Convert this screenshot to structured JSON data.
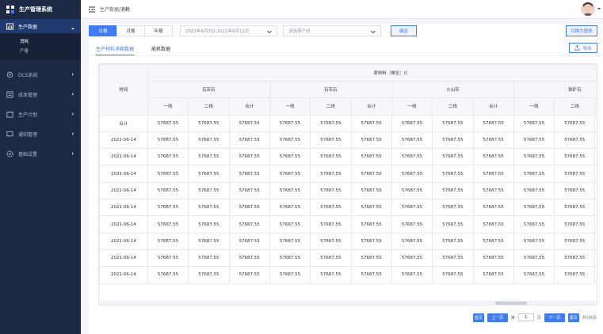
{
  "app": {
    "title": "生产管理系统"
  },
  "sidebar": {
    "items": [
      {
        "label": "生产数据",
        "icon": "chart-icon",
        "active": true,
        "children": [
          {
            "label": "消耗",
            "active": true
          },
          {
            "label": "产量",
            "active": false
          }
        ]
      },
      {
        "label": "DCS系统",
        "icon": "dcs-icon"
      },
      {
        "label": "成本管理",
        "icon": "cost-icon"
      },
      {
        "label": "生产计划",
        "icon": "plan-icon"
      },
      {
        "label": "通知管理",
        "icon": "message-icon"
      },
      {
        "label": "基础设置",
        "icon": "settings-icon"
      }
    ]
  },
  "header": {
    "breadcrumb_parent": "生产数据/",
    "breadcrumb_current": "消耗"
  },
  "filters": {
    "periods": [
      "日报",
      "月报",
      "年报"
    ],
    "active_period": "日报",
    "date_range": "2021年6月3日-2021年6月11日",
    "line_placeholder": "请选择产线",
    "confirm_label": "确定",
    "switch_chart_label": "切换为图表"
  },
  "subtabs": [
    "生产材料消耗数据",
    "能耗数据"
  ],
  "export_label": "导出",
  "table": {
    "time_header": "时间",
    "group_header": "原材料（单位：t）",
    "materials": [
      {
        "name": "石灰石",
        "cols": [
          "一线",
          "二线",
          "合计"
        ]
      },
      {
        "name": "石灰石",
        "cols": [
          "一线",
          "二线",
          "合计"
        ]
      },
      {
        "name": "火山灰",
        "cols": [
          "一线",
          "二线",
          "合计"
        ]
      },
      {
        "name": "铁矿石",
        "cols": [
          "一线",
          "二线",
          ""
        ]
      }
    ],
    "rows": [
      {
        "time": "合计",
        "cells": [
          "57687.55",
          "57687.55",
          "57687.55",
          "57687.55",
          "57687.55",
          "57687.55",
          "57687.55",
          "57687.55",
          "57687.55",
          "57687.55",
          "57687.55",
          ""
        ]
      },
      {
        "time": "2021-06-14",
        "cells": [
          "57687.55",
          "57687.55",
          "57687.55",
          "57687.55",
          "57687.55",
          "57687.55",
          "57687.55",
          "57687.55",
          "57687.55",
          "57687.55",
          "57687.55",
          ""
        ]
      },
      {
        "time": "2021-06-14",
        "cells": [
          "57687.55",
          "57687.55",
          "57687.55",
          "57687.55",
          "57687.55",
          "57687.55",
          "57687.55",
          "57687.55",
          "57687.55",
          "57687.55",
          "57687.55",
          ""
        ]
      },
      {
        "time": "2021-06-14",
        "cells": [
          "57687.55",
          "57687.55",
          "57687.55",
          "57687.55",
          "57687.55",
          "57687.55",
          "57687.55",
          "57687.55",
          "57687.55",
          "57687.55",
          "57687.55",
          ""
        ]
      },
      {
        "time": "2021-06-14",
        "cells": [
          "57687.55",
          "57687.55",
          "57687.55",
          "57687.55",
          "57687.55",
          "57687.55",
          "57687.55",
          "57687.55",
          "57687.55",
          "57687.55",
          "57687.55",
          ""
        ]
      },
      {
        "time": "2021-06-14",
        "cells": [
          "57687.55",
          "57687.55",
          "57687.55",
          "57687.55",
          "57687.55",
          "57687.55",
          "57687.55",
          "57687.55",
          "57687.55",
          "57687.55",
          "57687.55",
          ""
        ]
      },
      {
        "time": "2021-06-14",
        "cells": [
          "57687.55",
          "57687.55",
          "57687.55",
          "57687.55",
          "57687.55",
          "57687.55",
          "57687.55",
          "57687.55",
          "57687.55",
          "57687.55",
          "57687.55",
          ""
        ]
      },
      {
        "time": "2021-06-14",
        "cells": [
          "57687.55",
          "57687.55",
          "57687.55",
          "57687.55",
          "57687.55",
          "57687.55",
          "57687.55",
          "57687.55",
          "57687.55",
          "57687.55",
          "57687.55",
          ""
        ]
      },
      {
        "time": "2021-06-14",
        "cells": [
          "57687.55",
          "57687.55",
          "57687.55",
          "57687.55",
          "57687.55",
          "57687.55",
          "57687.55",
          "57687.55",
          "57687.55",
          "57687.55",
          "57687.55",
          ""
        ]
      },
      {
        "time": "2021-06-14",
        "cells": [
          "57687.55",
          "57687.55",
          "57687.55",
          "57687.55",
          "57687.55",
          "57687.55",
          "57687.55",
          "57687.55",
          "57687.55",
          "57687.55",
          "57687.55",
          ""
        ]
      }
    ]
  },
  "pagination": {
    "first": "首页",
    "prev": "上一页",
    "page_prefix": "第",
    "page_value": "1",
    "page_suffix": "页",
    "next": "下一页",
    "last": "尾页",
    "total": "共计6页"
  },
  "colors": {
    "accent": "#3d7bfa",
    "sidebar_bg": "#1e2a44",
    "sidebar_active": "#1f3a6f"
  }
}
